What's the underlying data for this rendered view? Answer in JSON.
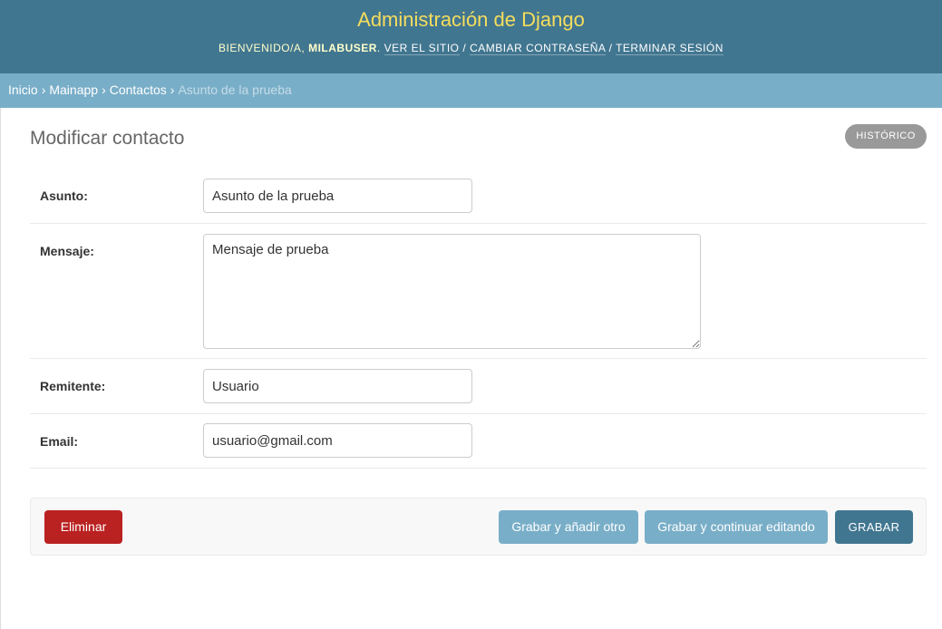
{
  "header": {
    "site_name": "Administración de Django",
    "welcome": "Bienvenido/a,",
    "username": "milabuser",
    "view_site": "Ver el sitio",
    "change_password": "Cambiar contraseña",
    "logout": "Terminar sesión",
    "separator": "/"
  },
  "breadcrumbs": {
    "separator": "›",
    "items": [
      "Inicio",
      "Mainapp",
      "Contactos"
    ],
    "current": "Asunto de la prueba"
  },
  "content": {
    "title": "Modificar contacto",
    "history_button": "Histórico"
  },
  "form": {
    "asunto": {
      "label": "Asunto:",
      "value": "Asunto de la prueba"
    },
    "mensaje": {
      "label": "Mensaje:",
      "value": "Mensaje de prueba"
    },
    "remitente": {
      "label": "Remitente:",
      "value": "Usuario"
    },
    "email": {
      "label": "Email:",
      "value": "usuario@gmail.com"
    }
  },
  "actions": {
    "delete": "Eliminar",
    "save_add_another": "Grabar y añadir otro",
    "save_continue": "Grabar y continuar editando",
    "save": "Grabar"
  },
  "colors": {
    "header_bg": "#417690",
    "site_name": "#f5dd5d",
    "breadcrumbs_bg": "#79aec8",
    "delete_button": "#ba2121",
    "primary_button": "#417690",
    "secondary_button": "#79aec8"
  }
}
